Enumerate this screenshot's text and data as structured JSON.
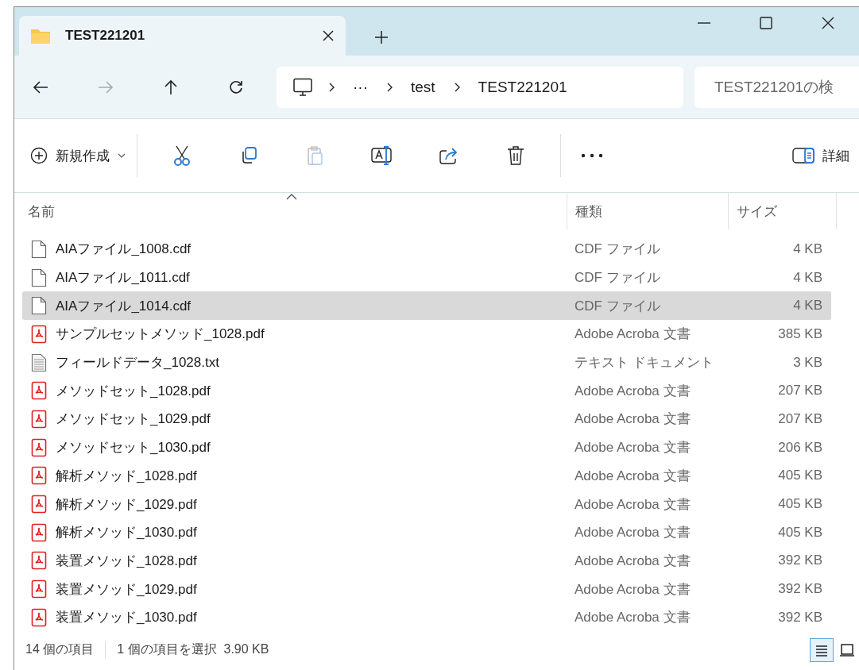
{
  "tab": {
    "title": "TEST221201",
    "selected": true
  },
  "breadcrumb": [
    "···",
    "test",
    "TEST221201"
  ],
  "search": {
    "placeholder": "TEST221201の検"
  },
  "toolbar": {
    "new_label": "新規作成",
    "details_label": "詳細"
  },
  "columns": [
    "名前",
    "種類",
    "サイズ"
  ],
  "files": [
    {
      "name": "AIAファイル_1008.cdf",
      "kind": "cdf",
      "type": "CDF ファイル",
      "size": "4 KB",
      "selected": false
    },
    {
      "name": "AIAファイル_1011.cdf",
      "kind": "cdf",
      "type": "CDF ファイル",
      "size": "4 KB",
      "selected": false
    },
    {
      "name": "AIAファイル_1014.cdf",
      "kind": "cdf",
      "type": "CDF ファイル",
      "size": "4 KB",
      "selected": true
    },
    {
      "name": "サンプルセットメソッド_1028.pdf",
      "kind": "pdf",
      "type": "Adobe Acroba 文書",
      "size": "385 KB",
      "selected": false
    },
    {
      "name": "フィールドデータ_1028.txt",
      "kind": "txt",
      "type": "テキスト ドキュメント",
      "size": "3 KB",
      "selected": false
    },
    {
      "name": "メソッドセット_1028.pdf",
      "kind": "pdf",
      "type": "Adobe Acroba 文書",
      "size": "207 KB",
      "selected": false
    },
    {
      "name": "メソッドセット_1029.pdf",
      "kind": "pdf",
      "type": "Adobe Acroba 文書",
      "size": "207 KB",
      "selected": false
    },
    {
      "name": "メソッドセット_1030.pdf",
      "kind": "pdf",
      "type": "Adobe Acroba 文書",
      "size": "206 KB",
      "selected": false
    },
    {
      "name": "解析メソッド_1028.pdf",
      "kind": "pdf",
      "type": "Adobe Acroba 文書",
      "size": "405 KB",
      "selected": false
    },
    {
      "name": "解析メソッド_1029.pdf",
      "kind": "pdf",
      "type": "Adobe Acroba 文書",
      "size": "405 KB",
      "selected": false
    },
    {
      "name": "解析メソッド_1030.pdf",
      "kind": "pdf",
      "type": "Adobe Acroba 文書",
      "size": "405 KB",
      "selected": false
    },
    {
      "name": "装置メソッド_1028.pdf",
      "kind": "pdf",
      "type": "Adobe Acroba 文書",
      "size": "392 KB",
      "selected": false
    },
    {
      "name": "装置メソッド_1029.pdf",
      "kind": "pdf",
      "type": "Adobe Acroba 文書",
      "size": "392 KB",
      "selected": false
    },
    {
      "name": "装置メソッド_1030.pdf",
      "kind": "pdf",
      "type": "Adobe Acroba 文書",
      "size": "392 KB",
      "selected": false
    }
  ],
  "status": {
    "count": "14 個の項目",
    "selection": "1 個の項目を選択  3.90 KB"
  },
  "views": [
    {
      "kind": "details",
      "selected": true
    },
    {
      "kind": "tiles",
      "selected": false
    }
  ]
}
